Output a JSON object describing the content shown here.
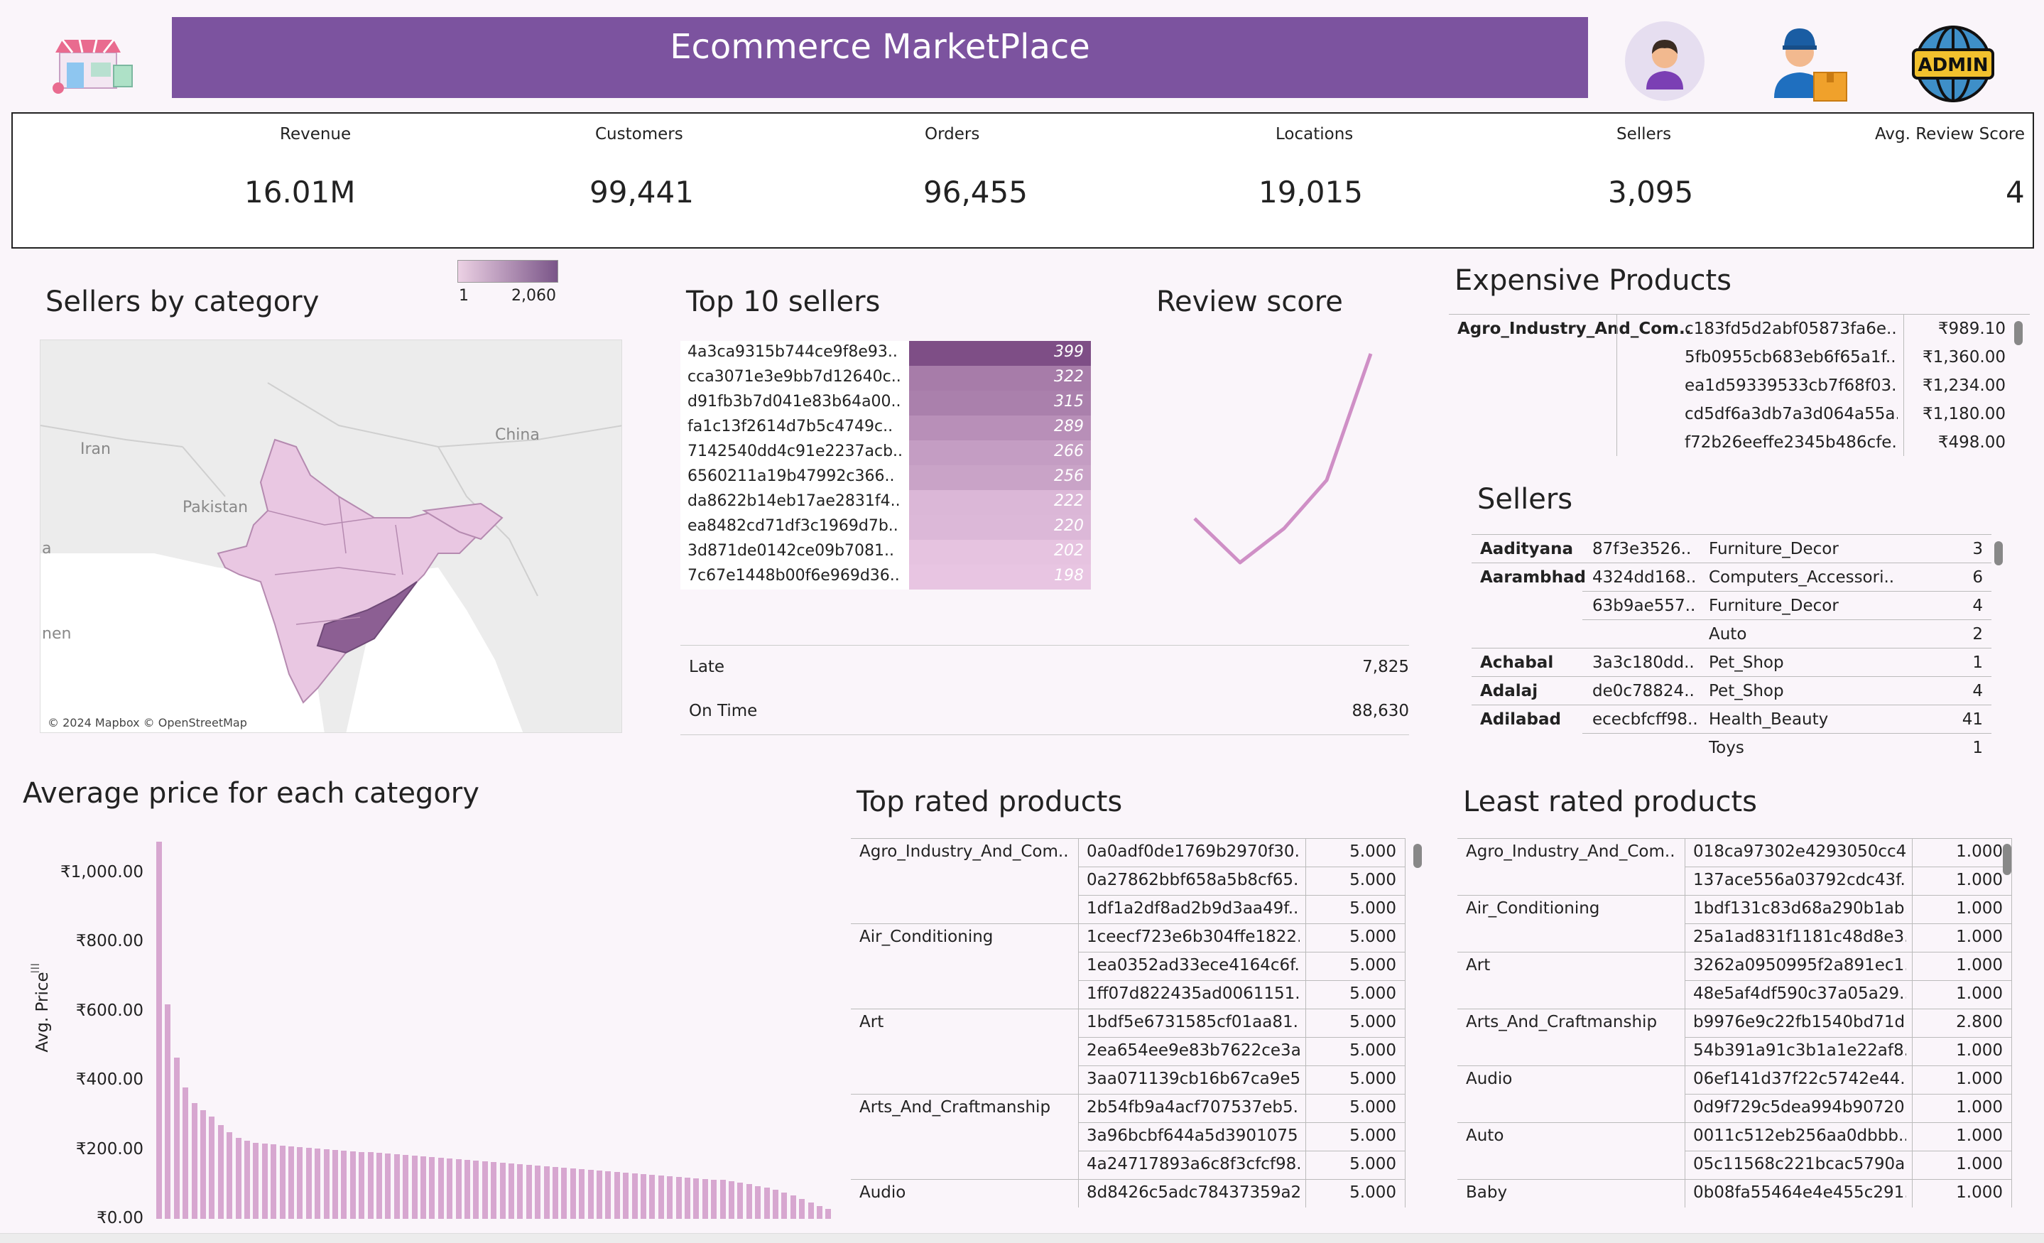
{
  "header": {
    "title": "Ecommerce MarketPlace",
    "icons": [
      "store-icon",
      "customer-icon",
      "delivery-person-icon",
      "admin-globe-icon"
    ],
    "accent": "#7c539f",
    "admin_label": "ADMIN"
  },
  "kpis": [
    {
      "label": "Revenue",
      "value": "16.01M"
    },
    {
      "label": "Customers",
      "value": "99,441"
    },
    {
      "label": "Orders",
      "value": "96,455"
    },
    {
      "label": "Locations",
      "value": "19,015"
    },
    {
      "label": "Sellers",
      "value": "3,095"
    },
    {
      "label": "Avg. Review Score",
      "value": "4"
    }
  ],
  "sellers_by_category": {
    "title": "Sellers by category",
    "legend_min": "1",
    "legend_max": "2,060",
    "map_labels": [
      "China",
      "Iran",
      "Pakistan",
      "a",
      "nen"
    ],
    "attribution": "© 2024 Mapbox © OpenStreetMap"
  },
  "top_sellers": {
    "title": "Top 10 sellers",
    "rows": [
      {
        "name": "4a3ca9315b744ce9f8e93..",
        "value": 399
      },
      {
        "name": "cca3071e3e9bb7d12640c..",
        "value": 322
      },
      {
        "name": "d91fb3b7d041e83b64a00..",
        "value": 315
      },
      {
        "name": "fa1c13f2614d7b5c4749c..",
        "value": 289
      },
      {
        "name": "7142540dd4c91e2237acb..",
        "value": 266
      },
      {
        "name": "6560211a19b47992c366..",
        "value": 256
      },
      {
        "name": "da8622b14eb17ae2831f4..",
        "value": 222
      },
      {
        "name": "ea8482cd71df3c1969d7b..",
        "value": 220
      },
      {
        "name": "3d871de0142ce09b7081..",
        "value": 202
      },
      {
        "name": "7c67e1448b00f6e969d36..",
        "value": 198
      }
    ]
  },
  "review_score": {
    "title": "Review score"
  },
  "delivery": {
    "rows": [
      {
        "label": "Late",
        "value": "7,825"
      },
      {
        "label": "On Time",
        "value": "88,630"
      }
    ]
  },
  "expensive_products": {
    "title": "Expensive Products",
    "category": "Agro_Industry_And_Com..",
    "rows": [
      {
        "id": "c183fd5d2abf05873fa6e..",
        "price": "₹989.10"
      },
      {
        "id": "5fb0955cb683eb6f65a1f..",
        "price": "₹1,360.00"
      },
      {
        "id": "ea1d59339533cb7f68f03..",
        "price": "₹1,234.00"
      },
      {
        "id": "cd5df6a3db7a3d064a55a..",
        "price": "₹1,180.00"
      },
      {
        "id": "f72b26eeffe2345b486cfe..",
        "price": "₹498.00"
      }
    ]
  },
  "sellers": {
    "title": "Sellers",
    "rows": [
      {
        "city": "Aadityana",
        "id": "87f3e3526..",
        "cat": "Furniture_Decor",
        "n": "3"
      },
      {
        "city": "Aarambhada",
        "id": "4324dd168..",
        "cat": "Computers_Accessori..",
        "n": "6"
      },
      {
        "city": "",
        "id": "63b9ae557..",
        "cat": "Furniture_Decor",
        "n": "4"
      },
      {
        "city": "",
        "id": "",
        "cat": "Auto",
        "n": "2"
      },
      {
        "city": "Achabal",
        "id": "3a3c180dd..",
        "cat": "Pet_Shop",
        "n": "1"
      },
      {
        "city": "Adalaj",
        "id": "de0c78824..",
        "cat": "Pet_Shop",
        "n": "4"
      },
      {
        "city": "Adilabad",
        "id": "ececbfcff98..",
        "cat": "Health_Beauty",
        "n": "41"
      },
      {
        "city": "",
        "id": "",
        "cat": "Toys",
        "n": "1"
      }
    ]
  },
  "avg_price": {
    "title": "Average price for each category",
    "y_label": "Avg. Price"
  },
  "chart_data": {
    "type": "bar",
    "title": "Average price for each category",
    "ylabel": "Avg. Price",
    "ylim": [
      0,
      1100
    ],
    "yticks": [
      "₹0.00",
      "₹200.00",
      "₹400.00",
      "₹600.00",
      "₹800.00",
      "₹1,000.00"
    ],
    "values": [
      1090,
      620,
      465,
      380,
      335,
      315,
      295,
      270,
      250,
      235,
      225,
      220,
      218,
      215,
      212,
      210,
      208,
      206,
      204,
      202,
      200,
      198,
      196,
      194,
      192,
      190,
      188,
      186,
      184,
      182,
      180,
      178,
      176,
      174,
      172,
      170,
      168,
      166,
      164,
      162,
      160,
      158,
      156,
      154,
      152,
      150,
      148,
      146,
      144,
      142,
      140,
      138,
      136,
      134,
      132,
      130,
      128,
      126,
      124,
      122,
      120,
      118,
      116,
      114,
      112,
      108,
      104,
      100,
      95,
      90,
      84,
      76,
      68,
      58,
      48,
      38,
      28
    ]
  },
  "top_rated": {
    "title": "Top rated products",
    "rows": [
      {
        "cat": "Agro_Industry_And_Com..",
        "id": "0a0adf0de1769b2970f30..",
        "score": "5.000"
      },
      {
        "cat": "",
        "id": "0a27862bbf658a5b8cf65..",
        "score": "5.000"
      },
      {
        "cat": "",
        "id": "1df1a2df8ad2b9d3aa49f..",
        "score": "5.000"
      },
      {
        "cat": "Air_Conditioning",
        "id": "1ceecf723e6b304ffe1822..",
        "score": "5.000"
      },
      {
        "cat": "",
        "id": "1ea0352ad33ece4164c6f..",
        "score": "5.000"
      },
      {
        "cat": "",
        "id": "1ff07d822435ad0061151..",
        "score": "5.000"
      },
      {
        "cat": "Art",
        "id": "1bdf5e6731585cf01aa81..",
        "score": "5.000"
      },
      {
        "cat": "",
        "id": "2ea654ee9e83b7622ce3a..",
        "score": "5.000"
      },
      {
        "cat": "",
        "id": "3aa071139cb16b67ca9e5..",
        "score": "5.000"
      },
      {
        "cat": "Arts_And_Craftmanship",
        "id": "2b54fb9a4acf707537eb5..",
        "score": "5.000"
      },
      {
        "cat": "",
        "id": "3a96bcbf644a5d3901075..",
        "score": "5.000"
      },
      {
        "cat": "",
        "id": "4a24717893a6c8f3cfcf98..",
        "score": "5.000"
      },
      {
        "cat": "Audio",
        "id": "8d8426c5adc78437359a2..",
        "score": "5.000"
      }
    ]
  },
  "least_rated": {
    "title": "Least rated products",
    "rows": [
      {
        "cat": "Agro_Industry_And_Com..",
        "id": "018ca97302e4293050cc4..",
        "score": "1.000"
      },
      {
        "cat": "",
        "id": "137ace556a03792cdc43f..",
        "score": "1.000"
      },
      {
        "cat": "Air_Conditioning",
        "id": "1bdf131c83d68a290b1ab..",
        "score": "1.000"
      },
      {
        "cat": "",
        "id": "25a1ad831f1181c48d8e3..",
        "score": "1.000"
      },
      {
        "cat": "Art",
        "id": "3262a0950995f2a891ec1..",
        "score": "1.000"
      },
      {
        "cat": "",
        "id": "48e5af4df590c37a05a29..",
        "score": "1.000"
      },
      {
        "cat": "Arts_And_Craftmanship",
        "id": "b9976e9c22fb1540bd71d..",
        "score": "2.800"
      },
      {
        "cat": "",
        "id": "54b391a91c3b1a1e22af8..",
        "score": "1.000"
      },
      {
        "cat": "Audio",
        "id": "06ef141d37f22c5742e44..",
        "score": "1.000"
      },
      {
        "cat": "",
        "id": "0d9f729c5dea994b90720..",
        "score": "1.000"
      },
      {
        "cat": "Auto",
        "id": "0011c512eb256aa0dbbb..",
        "score": "1.000"
      },
      {
        "cat": "",
        "id": "05c11568c221bcac5790a..",
        "score": "1.000"
      },
      {
        "cat": "Baby",
        "id": "0b08fa55464e4e455c291..",
        "score": "1.000"
      }
    ]
  }
}
